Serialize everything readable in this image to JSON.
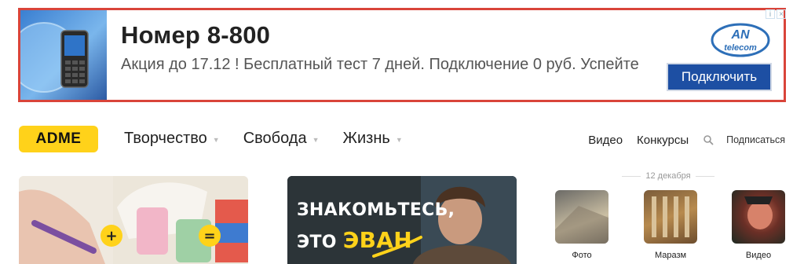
{
  "ad": {
    "title": "Номер 8-800",
    "text": "Акция до 17.12 ! Бесплатный тест 7 дней. Подключение 0 руб. Успейте",
    "cta": "Подключить",
    "logo_text": "AN telecom",
    "logo_main": "AN",
    "logo_sub": "telecom",
    "info_icon": "i",
    "close_icon": "×",
    "border_color": "#d9443a",
    "cta_color": "#1d4fa3"
  },
  "header": {
    "logo": "ADME",
    "logo_color": "#ffd21a",
    "nav": [
      {
        "label": "Творчество"
      },
      {
        "label": "Свобода"
      },
      {
        "label": "Жизнь"
      }
    ],
    "right": {
      "video": "Видео",
      "contests": "Конкурсы",
      "subscribe": "Подписаться"
    }
  },
  "cards": {
    "card2_line1": "ЗНАКОМЬТЕСЬ,",
    "card2_line2_a": "ЭТО",
    "card2_line2_b": "ЭВАН"
  },
  "sidebar": {
    "date": "12 декабря",
    "thumbs": [
      {
        "label": "Фото"
      },
      {
        "label": "Маразм"
      },
      {
        "label": "Видео"
      }
    ]
  }
}
